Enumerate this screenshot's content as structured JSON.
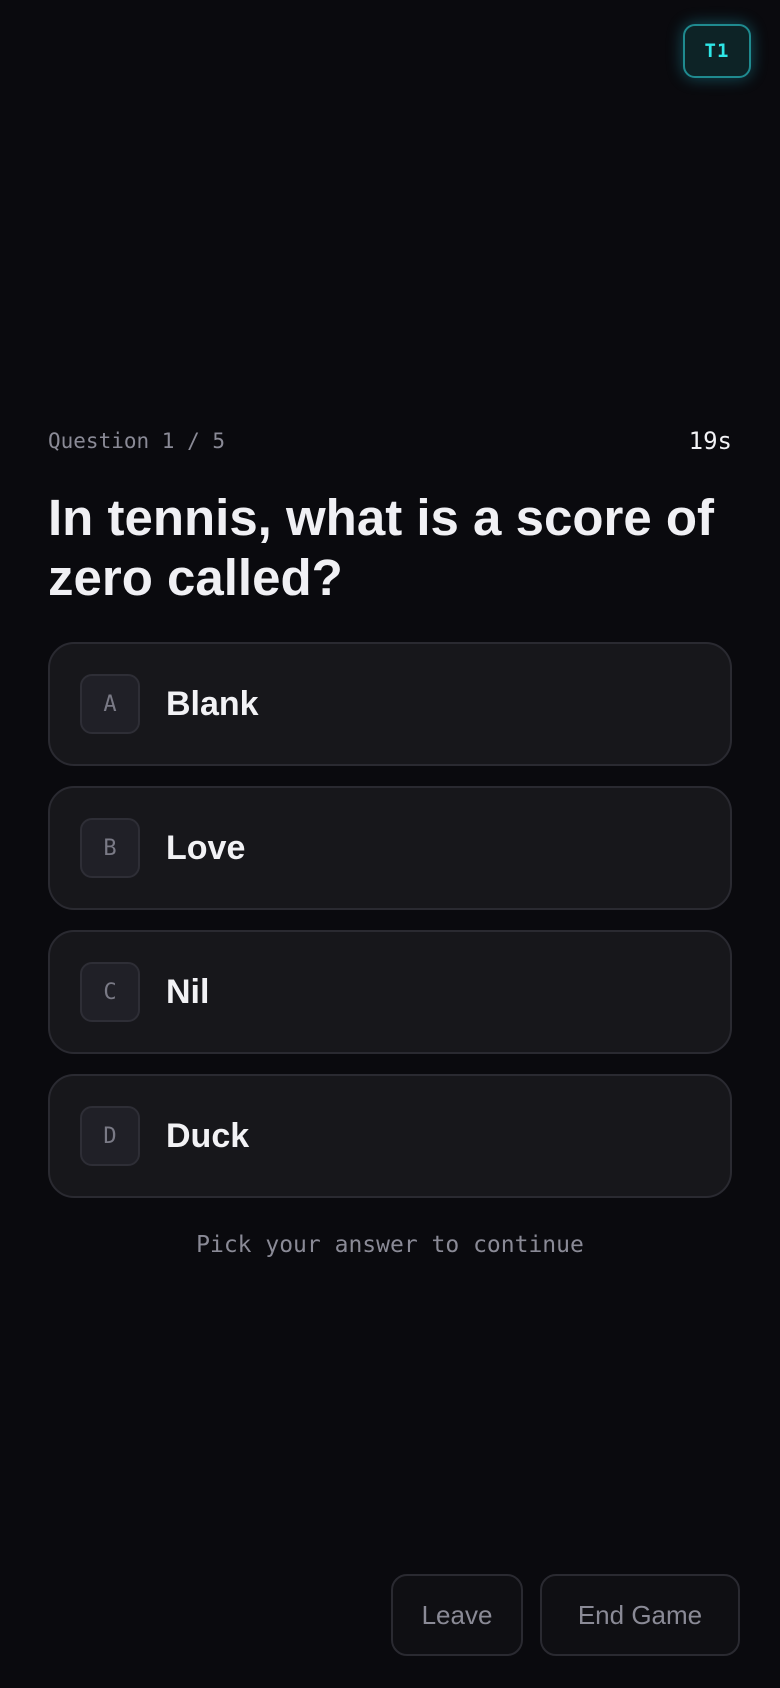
{
  "header": {
    "team_badge": "T1"
  },
  "quiz": {
    "counter": "Question 1 / 5",
    "timer": "19s",
    "question": "In tennis, what is a score of zero called?",
    "options": [
      {
        "letter": "A",
        "text": "Blank"
      },
      {
        "letter": "B",
        "text": "Love"
      },
      {
        "letter": "C",
        "text": "Nil"
      },
      {
        "letter": "D",
        "text": "Duck"
      }
    ],
    "hint": "Pick your answer to continue"
  },
  "footer": {
    "leave_label": "Leave",
    "end_game_label": "End Game"
  },
  "colors": {
    "background": "#0a0a0e",
    "accent": "#2ee6e6",
    "card": "#17171b",
    "muted_text": "#8a8a96"
  }
}
